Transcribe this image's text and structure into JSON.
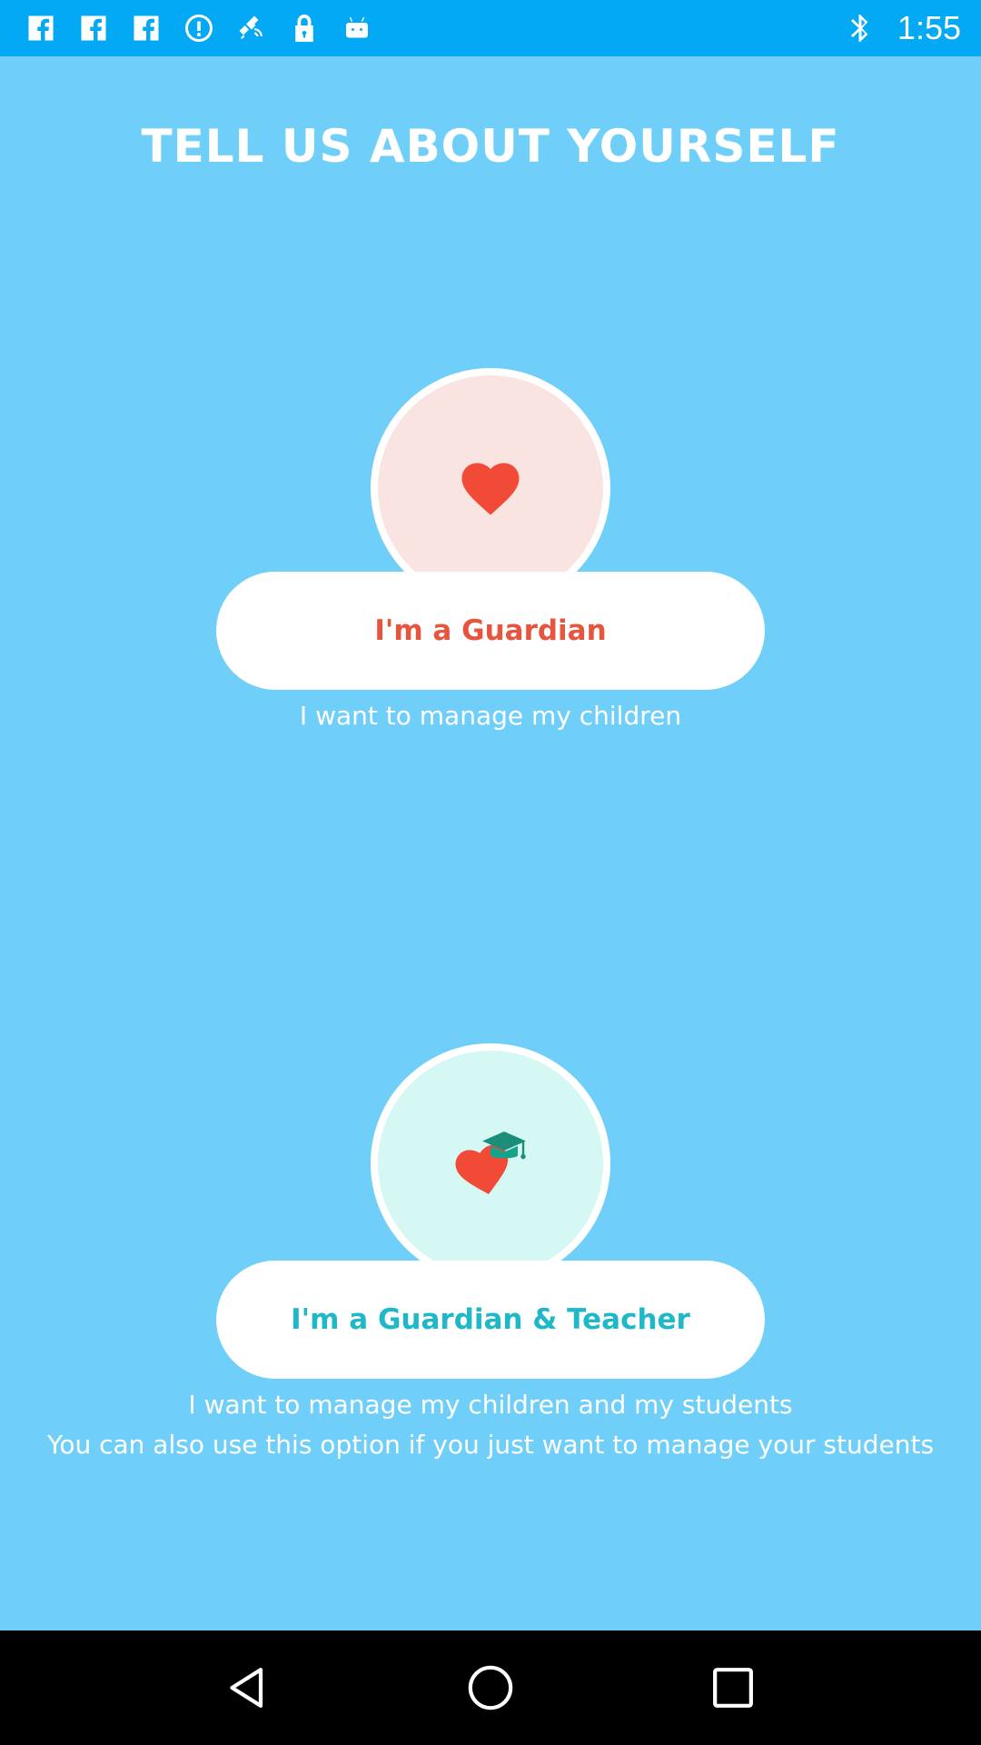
{
  "status_bar": {
    "time": "1:55",
    "left_icons": [
      "facebook-icon",
      "facebook-icon",
      "facebook-icon",
      "alert-icon",
      "satellite-fake-gps-icon",
      "lock-icon",
      "android-icon"
    ],
    "right_icons": [
      "bluetooth-icon"
    ]
  },
  "header": {
    "title": "TELL US ABOUT YOURSELF"
  },
  "options": [
    {
      "button_label": "I'm a Guardian",
      "description_lines": [
        "I want to manage my children"
      ],
      "icon": "heart-icon",
      "accent_color": "#E8553E",
      "circle_color": "#FAE4E2"
    },
    {
      "button_label": "I'm a Guardian & Teacher",
      "description_lines": [
        "I want to manage my children and my students",
        "You can also use this option if you just want to manage your students"
      ],
      "icon": "heart-graduation-cap-icon",
      "accent_color": "#1EB8C8",
      "circle_color": "#D6F8F5"
    }
  ],
  "navigation": {
    "icons": [
      "back-icon",
      "home-icon",
      "recents-icon"
    ]
  },
  "colors": {
    "background": "#70CFF8",
    "status_bar": "#03A9F4",
    "nav_bar": "#000000"
  }
}
